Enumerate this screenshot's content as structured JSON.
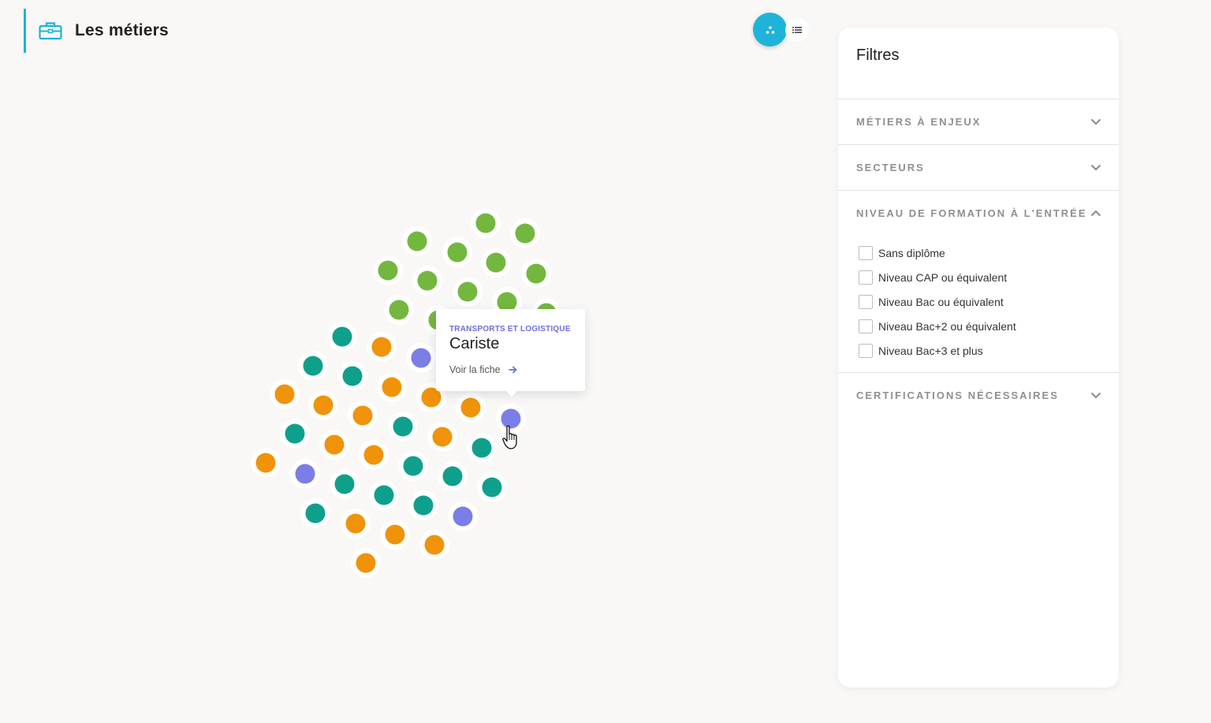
{
  "header": {
    "title": "Les métiers",
    "icon": "briefcase-icon"
  },
  "view_toggle": {
    "bubble_icon": "bubble-view-icon",
    "list_icon": "list-view-icon",
    "active": "bubble"
  },
  "colors": {
    "accent": "#1fb3d9",
    "green": "#73b73f",
    "teal": "#0fa08c",
    "orange": "#f0930a",
    "purple": "#7a7ee6"
  },
  "bubbles": [
    {
      "c": "green"
    },
    {
      "c": "green"
    },
    {
      "c": "green"
    },
    {
      "c": "green"
    },
    {
      "c": "green"
    },
    {
      "c": "green"
    },
    {
      "c": "green"
    },
    {
      "c": "green"
    },
    {
      "c": "green"
    },
    {
      "c": "green"
    },
    {
      "c": "green"
    },
    {
      "c": "green"
    },
    {
      "c": "green"
    },
    {
      "c": "teal"
    },
    {
      "c": "orange"
    },
    {
      "c": "purple"
    },
    {
      "c": "teal"
    },
    {
      "c": "teal"
    },
    {
      "c": "orange"
    },
    {
      "c": "orange"
    },
    {
      "c": "orange"
    },
    {
      "c": "orange"
    },
    {
      "c": "orange"
    },
    {
      "c": "orange"
    },
    {
      "c": "purple"
    },
    {
      "c": "teal"
    },
    {
      "c": "orange"
    },
    {
      "c": "teal"
    },
    {
      "c": "orange"
    },
    {
      "c": "teal"
    },
    {
      "c": "orange"
    },
    {
      "c": "orange"
    },
    {
      "c": "purple"
    },
    {
      "c": "teal"
    },
    {
      "c": "teal"
    },
    {
      "c": "teal"
    },
    {
      "c": "teal"
    },
    {
      "c": "teal"
    },
    {
      "c": "teal"
    },
    {
      "c": "teal"
    },
    {
      "c": "purple"
    },
    {
      "c": "orange"
    },
    {
      "c": "orange"
    },
    {
      "c": "orange"
    },
    {
      "c": "orange"
    }
  ],
  "tooltip": {
    "category": "TRANSPORTS ET LOGISTIQUE",
    "title": "Cariste",
    "link_label": "Voir la fiche"
  },
  "filters": {
    "title": "Filtres",
    "sections": [
      {
        "label": "MÉTIERS À ENJEUX",
        "expanded": false
      },
      {
        "label": "SECTEURS",
        "expanded": false
      },
      {
        "label": "NIVEAU DE FORMATION À L'ENTRÉE",
        "expanded": true,
        "options": [
          "Sans diplôme",
          "Niveau CAP ou équivalent",
          "Niveau Bac ou équivalent",
          "Niveau Bac+2 ou équivalent",
          "Niveau Bac+3 et plus"
        ]
      },
      {
        "label": "CERTIFICATIONS NÉCESSAIRES",
        "expanded": false
      }
    ]
  }
}
